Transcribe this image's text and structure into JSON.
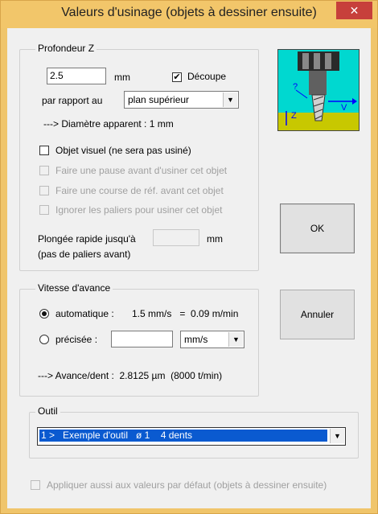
{
  "window": {
    "title": "Valeurs d'usinage (objets à dessiner ensuite)",
    "close_glyph": "✕"
  },
  "profondeur": {
    "legend": "Profondeur Z",
    "depth_value": "2.5",
    "depth_unit": "mm",
    "decoupe_label": "Découpe",
    "decoupe_checked": true,
    "par_rapport_label": "par rapport au",
    "reference_value": "plan supérieur",
    "diametre_text": "---> Diamètre apparent : 1 mm",
    "objet_visuel_label": "Objet visuel  (ne sera pas usiné)",
    "pause_label": "Faire une pause avant d'usiner cet objet",
    "course_label": "Faire une course de réf. avant cet objet",
    "ignorer_label": "Ignorer les paliers pour usiner cet objet",
    "plongee_label_1": "Plongée rapide jusqu'à",
    "plongee_label_2": "(pas de paliers avant)",
    "plongee_value": "",
    "plongee_unit": "mm"
  },
  "illustration": {
    "z_label": "Z",
    "v_label": "V",
    "question": "?"
  },
  "vitesse": {
    "legend": "Vitesse d'avance",
    "auto_label": "automatique :",
    "auto_value": "1.5 mm/s   =  0.09 m/min",
    "precisee_label": "précisée :",
    "precisee_value": "",
    "unit_value": "mm/s",
    "avance_text": "---> Avance/dent :  2.8125 µm  (8000 t/min)"
  },
  "outil": {
    "legend": "Outil",
    "selected": "1 >   Exemple d'outil   ø 1    4 dents"
  },
  "buttons": {
    "ok": "OK",
    "annuler": "Annuler"
  },
  "footer": {
    "appliquer_label": "Appliquer aussi aux valeurs par défaut  (objets à dessiner ensuite)"
  }
}
